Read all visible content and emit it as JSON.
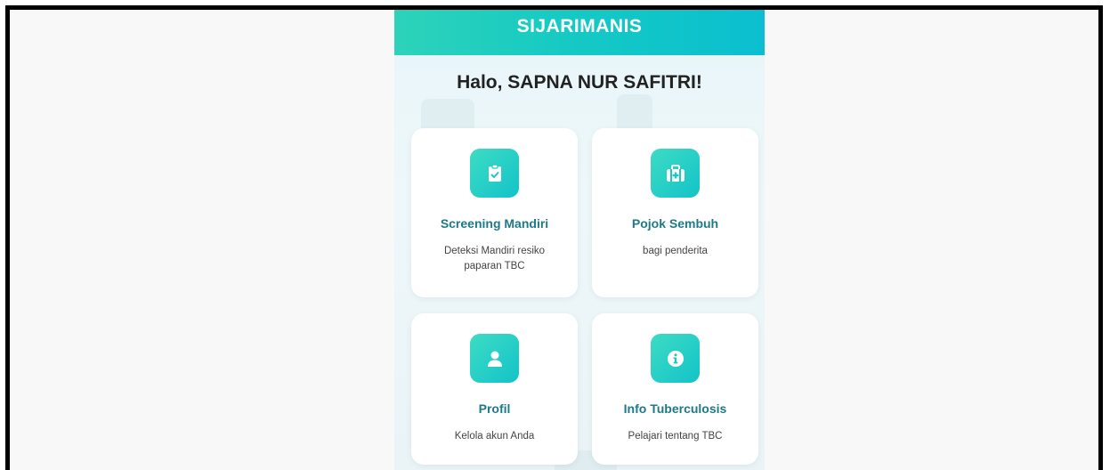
{
  "app": {
    "title": "SIJARIMANIS",
    "greeting": "Halo, SAPNA NUR SAFITRI!"
  },
  "menu": [
    {
      "title": "Screening Mandiri",
      "description": "Deteksi Mandiri resiko paparan TBC",
      "icon": "clipboard-check-icon"
    },
    {
      "title": "Pojok Sembuh",
      "description": "bagi penderita",
      "icon": "medkit-icon"
    },
    {
      "title": "Profil",
      "description": "Kelola akun Anda",
      "icon": "user-icon"
    },
    {
      "title": "Info Tuberculosis",
      "description": "Pelajari tentang TBC",
      "icon": "info-icon"
    }
  ],
  "colors": {
    "accent": "#14c9c4",
    "card_title": "#1e7a86"
  }
}
